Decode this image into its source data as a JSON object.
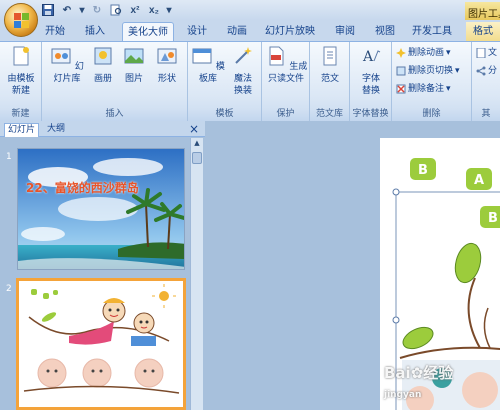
{
  "qat": {
    "save": "",
    "undo": "↶",
    "redo": "↷",
    "redo2": "↻",
    "superscript": "x²",
    "subscript": "x₂",
    "more": "▾"
  },
  "title": {
    "context_tab_group": "图片工具"
  },
  "tabs": [
    {
      "label": "开始"
    },
    {
      "label": "插入"
    },
    {
      "label": "美化大师"
    },
    {
      "label": "设计"
    },
    {
      "label": "动画"
    },
    {
      "label": "幻灯片放映"
    },
    {
      "label": "审阅"
    },
    {
      "label": "视图"
    },
    {
      "label": "开发工具"
    },
    {
      "label": "格式"
    }
  ],
  "ribbon": {
    "groups": {
      "new": "新建",
      "insert": "插入",
      "template": "模板",
      "protect": "保护",
      "sample": "范文库",
      "font_replace": "字体替换",
      "delete": "删除",
      "other": "其"
    },
    "buttons": {
      "from_template_new": "由模板\n新建",
      "slide_library": "幻灯片库",
      "album": "画册",
      "picture": "图片",
      "shape": "形状",
      "template_library": "模板库",
      "magic_replace": "魔法\n换装",
      "gen_readonly": "生成\n只读文件",
      "sample": "范文",
      "font_replace": "字体\n替换",
      "delete_animation": "删除动画",
      "delete_transition": "删除页切换",
      "delete_notes": "删除备注",
      "doc_cut": "文",
      "split": "分"
    }
  },
  "panel": {
    "tabs": [
      "幻灯片",
      "大纲"
    ],
    "close": "×",
    "slides": [
      {
        "number": "1",
        "title": "22、富饶的西沙群岛"
      },
      {
        "number": "2",
        "title": ""
      }
    ]
  },
  "canvas": {
    "tags": [
      "B",
      "A",
      "B"
    ]
  },
  "watermark": {
    "text": "Bai",
    "text2": "经验",
    "sub": "jingyan"
  },
  "colors": {
    "slide1_title": "#e8542a",
    "tag_green": "#9ccc3c",
    "selection": "#f4a33a"
  }
}
